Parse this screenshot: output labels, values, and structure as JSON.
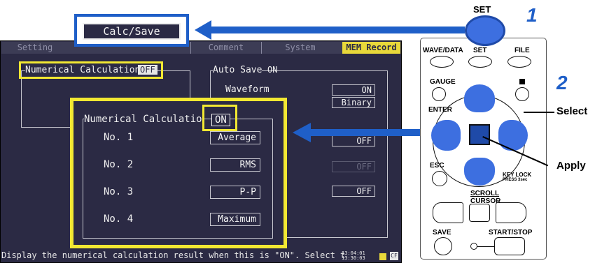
{
  "tabs": [
    "Setting",
    "Comment",
    "System",
    "MEM Record"
  ],
  "calc_save_label": "Calc/Save",
  "screen": {
    "numerical_calc_label": "Numerical Calculation",
    "numerical_calc_value": "OFF",
    "auto_save_label": "Auto Save",
    "auto_save_value": "ON",
    "waveform_label": "Waveform",
    "waveform_value": "ON",
    "waveform_format": "Binary",
    "right_values": [
      "OFF",
      "OFF",
      "OFF"
    ],
    "status_text": "Display the numerical calculation result when this is \"ON\". Select t",
    "status_time": "13:04:01\n13:30:03",
    "status_card": "CF"
  },
  "zoom": {
    "title": "Numerical Calculatio",
    "value": "ON",
    "rows": [
      {
        "label": "No. 1",
        "value": "Average"
      },
      {
        "label": "No. 2",
        "value": "RMS"
      },
      {
        "label": "No. 3",
        "value": "P-P"
      },
      {
        "label": "No. 4",
        "value": "Maximum"
      }
    ]
  },
  "keypad": {
    "set_top": "SET",
    "wave_data": "WAVE/DATA",
    "set": "SET",
    "file": "FILE",
    "gauge": "GAUGE",
    "enter": "ENTER",
    "esc": "ESC",
    "key_lock": "KEY LOCK",
    "press": "PRESS 3sec",
    "scroll": "SCROLL",
    "cursor": "CURSOR",
    "save": "SAVE",
    "start_stop": "START/STOP"
  },
  "steps": [
    "1",
    "2"
  ],
  "callouts": {
    "select": "Select",
    "apply": "Apply"
  },
  "colors": {
    "accent_blue": "#1f5fc8",
    "highlight_yellow": "#f2e832",
    "lcd_bg": "#2b2a44"
  }
}
